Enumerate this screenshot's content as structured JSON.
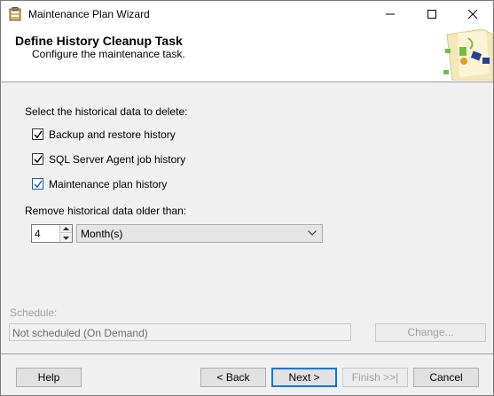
{
  "window": {
    "title": "Maintenance Plan Wizard"
  },
  "header": {
    "title": "Define History Cleanup Task",
    "subtitle": "Configure the maintenance task."
  },
  "main": {
    "select_label": "Select the historical data to delete:",
    "options": [
      {
        "label": "Backup and restore history",
        "checked": true
      },
      {
        "label": "SQL Server Agent job history",
        "checked": true
      },
      {
        "label": "Maintenance plan history",
        "checked": true
      }
    ],
    "remove_label": "Remove historical data older than:",
    "age_value": "4",
    "age_unit": "Month(s)"
  },
  "schedule": {
    "label": "Schedule:",
    "value": "Not scheduled (On Demand)",
    "change_label": "Change..."
  },
  "footer": {
    "help": "Help",
    "back": "< Back",
    "next": "Next >",
    "finish": "Finish >>|",
    "cancel": "Cancel"
  },
  "colors": {
    "accent": "#0078d7",
    "disabled_text": "#a0a0a0"
  }
}
